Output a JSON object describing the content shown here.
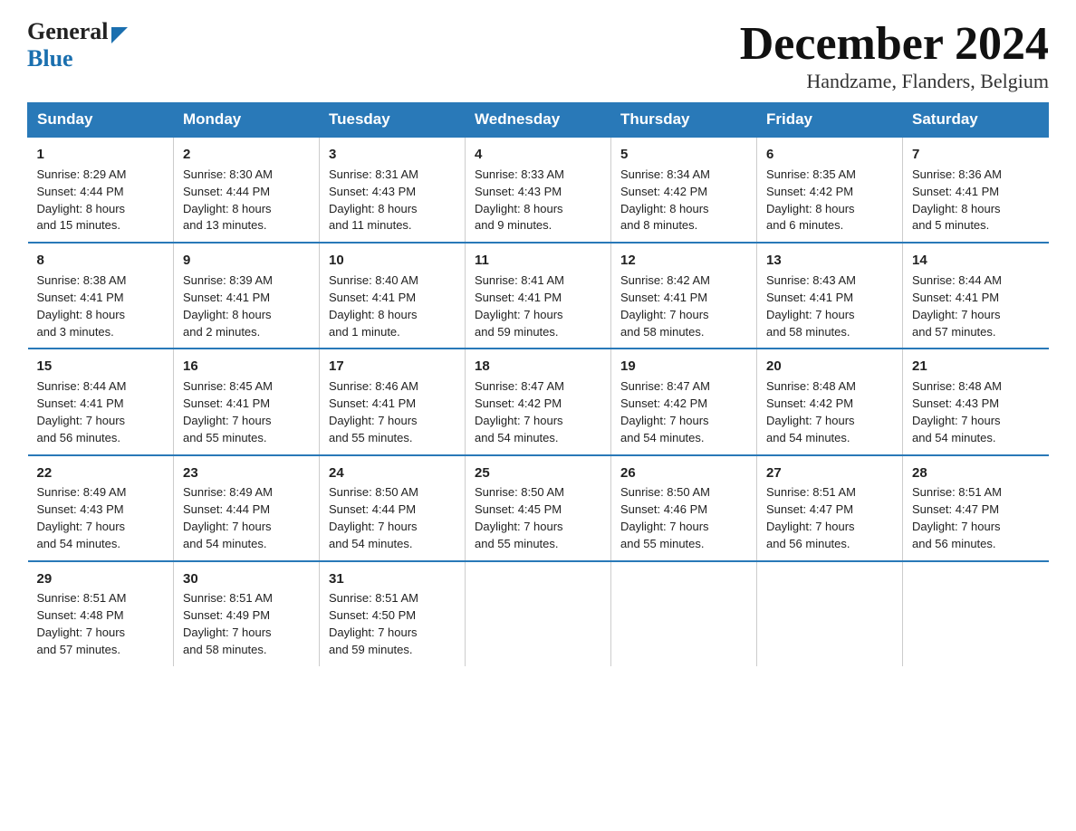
{
  "logo": {
    "general": "General",
    "blue": "Blue"
  },
  "title": "December 2024",
  "subtitle": "Handzame, Flanders, Belgium",
  "header_days": [
    "Sunday",
    "Monday",
    "Tuesday",
    "Wednesday",
    "Thursday",
    "Friday",
    "Saturday"
  ],
  "weeks": [
    [
      {
        "day": "1",
        "info": "Sunrise: 8:29 AM\nSunset: 4:44 PM\nDaylight: 8 hours\nand 15 minutes."
      },
      {
        "day": "2",
        "info": "Sunrise: 8:30 AM\nSunset: 4:44 PM\nDaylight: 8 hours\nand 13 minutes."
      },
      {
        "day": "3",
        "info": "Sunrise: 8:31 AM\nSunset: 4:43 PM\nDaylight: 8 hours\nand 11 minutes."
      },
      {
        "day": "4",
        "info": "Sunrise: 8:33 AM\nSunset: 4:43 PM\nDaylight: 8 hours\nand 9 minutes."
      },
      {
        "day": "5",
        "info": "Sunrise: 8:34 AM\nSunset: 4:42 PM\nDaylight: 8 hours\nand 8 minutes."
      },
      {
        "day": "6",
        "info": "Sunrise: 8:35 AM\nSunset: 4:42 PM\nDaylight: 8 hours\nand 6 minutes."
      },
      {
        "day": "7",
        "info": "Sunrise: 8:36 AM\nSunset: 4:41 PM\nDaylight: 8 hours\nand 5 minutes."
      }
    ],
    [
      {
        "day": "8",
        "info": "Sunrise: 8:38 AM\nSunset: 4:41 PM\nDaylight: 8 hours\nand 3 minutes."
      },
      {
        "day": "9",
        "info": "Sunrise: 8:39 AM\nSunset: 4:41 PM\nDaylight: 8 hours\nand 2 minutes."
      },
      {
        "day": "10",
        "info": "Sunrise: 8:40 AM\nSunset: 4:41 PM\nDaylight: 8 hours\nand 1 minute."
      },
      {
        "day": "11",
        "info": "Sunrise: 8:41 AM\nSunset: 4:41 PM\nDaylight: 7 hours\nand 59 minutes."
      },
      {
        "day": "12",
        "info": "Sunrise: 8:42 AM\nSunset: 4:41 PM\nDaylight: 7 hours\nand 58 minutes."
      },
      {
        "day": "13",
        "info": "Sunrise: 8:43 AM\nSunset: 4:41 PM\nDaylight: 7 hours\nand 58 minutes."
      },
      {
        "day": "14",
        "info": "Sunrise: 8:44 AM\nSunset: 4:41 PM\nDaylight: 7 hours\nand 57 minutes."
      }
    ],
    [
      {
        "day": "15",
        "info": "Sunrise: 8:44 AM\nSunset: 4:41 PM\nDaylight: 7 hours\nand 56 minutes."
      },
      {
        "day": "16",
        "info": "Sunrise: 8:45 AM\nSunset: 4:41 PM\nDaylight: 7 hours\nand 55 minutes."
      },
      {
        "day": "17",
        "info": "Sunrise: 8:46 AM\nSunset: 4:41 PM\nDaylight: 7 hours\nand 55 minutes."
      },
      {
        "day": "18",
        "info": "Sunrise: 8:47 AM\nSunset: 4:42 PM\nDaylight: 7 hours\nand 54 minutes."
      },
      {
        "day": "19",
        "info": "Sunrise: 8:47 AM\nSunset: 4:42 PM\nDaylight: 7 hours\nand 54 minutes."
      },
      {
        "day": "20",
        "info": "Sunrise: 8:48 AM\nSunset: 4:42 PM\nDaylight: 7 hours\nand 54 minutes."
      },
      {
        "day": "21",
        "info": "Sunrise: 8:48 AM\nSunset: 4:43 PM\nDaylight: 7 hours\nand 54 minutes."
      }
    ],
    [
      {
        "day": "22",
        "info": "Sunrise: 8:49 AM\nSunset: 4:43 PM\nDaylight: 7 hours\nand 54 minutes."
      },
      {
        "day": "23",
        "info": "Sunrise: 8:49 AM\nSunset: 4:44 PM\nDaylight: 7 hours\nand 54 minutes."
      },
      {
        "day": "24",
        "info": "Sunrise: 8:50 AM\nSunset: 4:44 PM\nDaylight: 7 hours\nand 54 minutes."
      },
      {
        "day": "25",
        "info": "Sunrise: 8:50 AM\nSunset: 4:45 PM\nDaylight: 7 hours\nand 55 minutes."
      },
      {
        "day": "26",
        "info": "Sunrise: 8:50 AM\nSunset: 4:46 PM\nDaylight: 7 hours\nand 55 minutes."
      },
      {
        "day": "27",
        "info": "Sunrise: 8:51 AM\nSunset: 4:47 PM\nDaylight: 7 hours\nand 56 minutes."
      },
      {
        "day": "28",
        "info": "Sunrise: 8:51 AM\nSunset: 4:47 PM\nDaylight: 7 hours\nand 56 minutes."
      }
    ],
    [
      {
        "day": "29",
        "info": "Sunrise: 8:51 AM\nSunset: 4:48 PM\nDaylight: 7 hours\nand 57 minutes."
      },
      {
        "day": "30",
        "info": "Sunrise: 8:51 AM\nSunset: 4:49 PM\nDaylight: 7 hours\nand 58 minutes."
      },
      {
        "day": "31",
        "info": "Sunrise: 8:51 AM\nSunset: 4:50 PM\nDaylight: 7 hours\nand 59 minutes."
      },
      {
        "day": "",
        "info": ""
      },
      {
        "day": "",
        "info": ""
      },
      {
        "day": "",
        "info": ""
      },
      {
        "day": "",
        "info": ""
      }
    ]
  ]
}
